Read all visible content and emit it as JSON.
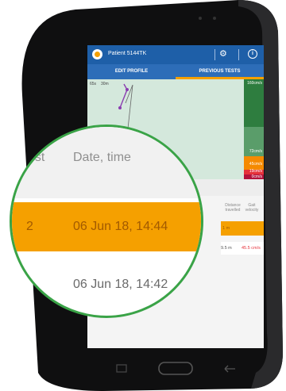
{
  "app": {
    "patient": "Patient 5144TK"
  },
  "tabs": {
    "edit_profile": "EDIT PROFILE",
    "previous_tests": "PREVIOUS TESTS"
  },
  "icons": {
    "gear": "⚙",
    "info": "i"
  },
  "chart": {
    "left_labels": [
      "65s",
      "30m"
    ],
    "zones": [
      {
        "label": "160cm/s",
        "color": "#2e7d3f"
      },
      {
        "label": "72cm/s",
        "color": "#5a9d6a"
      },
      {
        "label": "45cm/s",
        "color": "#f58a00"
      },
      {
        "label": "19cm/s",
        "color": "#e6323a"
      },
      {
        "label": "0cm/s",
        "color": "#b3123b"
      }
    ]
  },
  "table": {
    "header_test": "est",
    "header_date": "Date, time",
    "header_distance": "Distance travelled",
    "header_gait": "Gait velocity",
    "rows": [
      {
        "test": "2",
        "date": "06 Jun 18, 14:44",
        "distance": "1 m",
        "velocity": ""
      },
      {
        "test": "",
        "date": "06 Jun 18, 14:42",
        "distance": "9.5 m",
        "velocity": "45.5 cm/s"
      }
    ]
  },
  "colors": {
    "primary": "#1e5fa8",
    "accent": "#f5a000",
    "magnifier_border": "#3aa347",
    "velocity_red": "#e6323a"
  }
}
